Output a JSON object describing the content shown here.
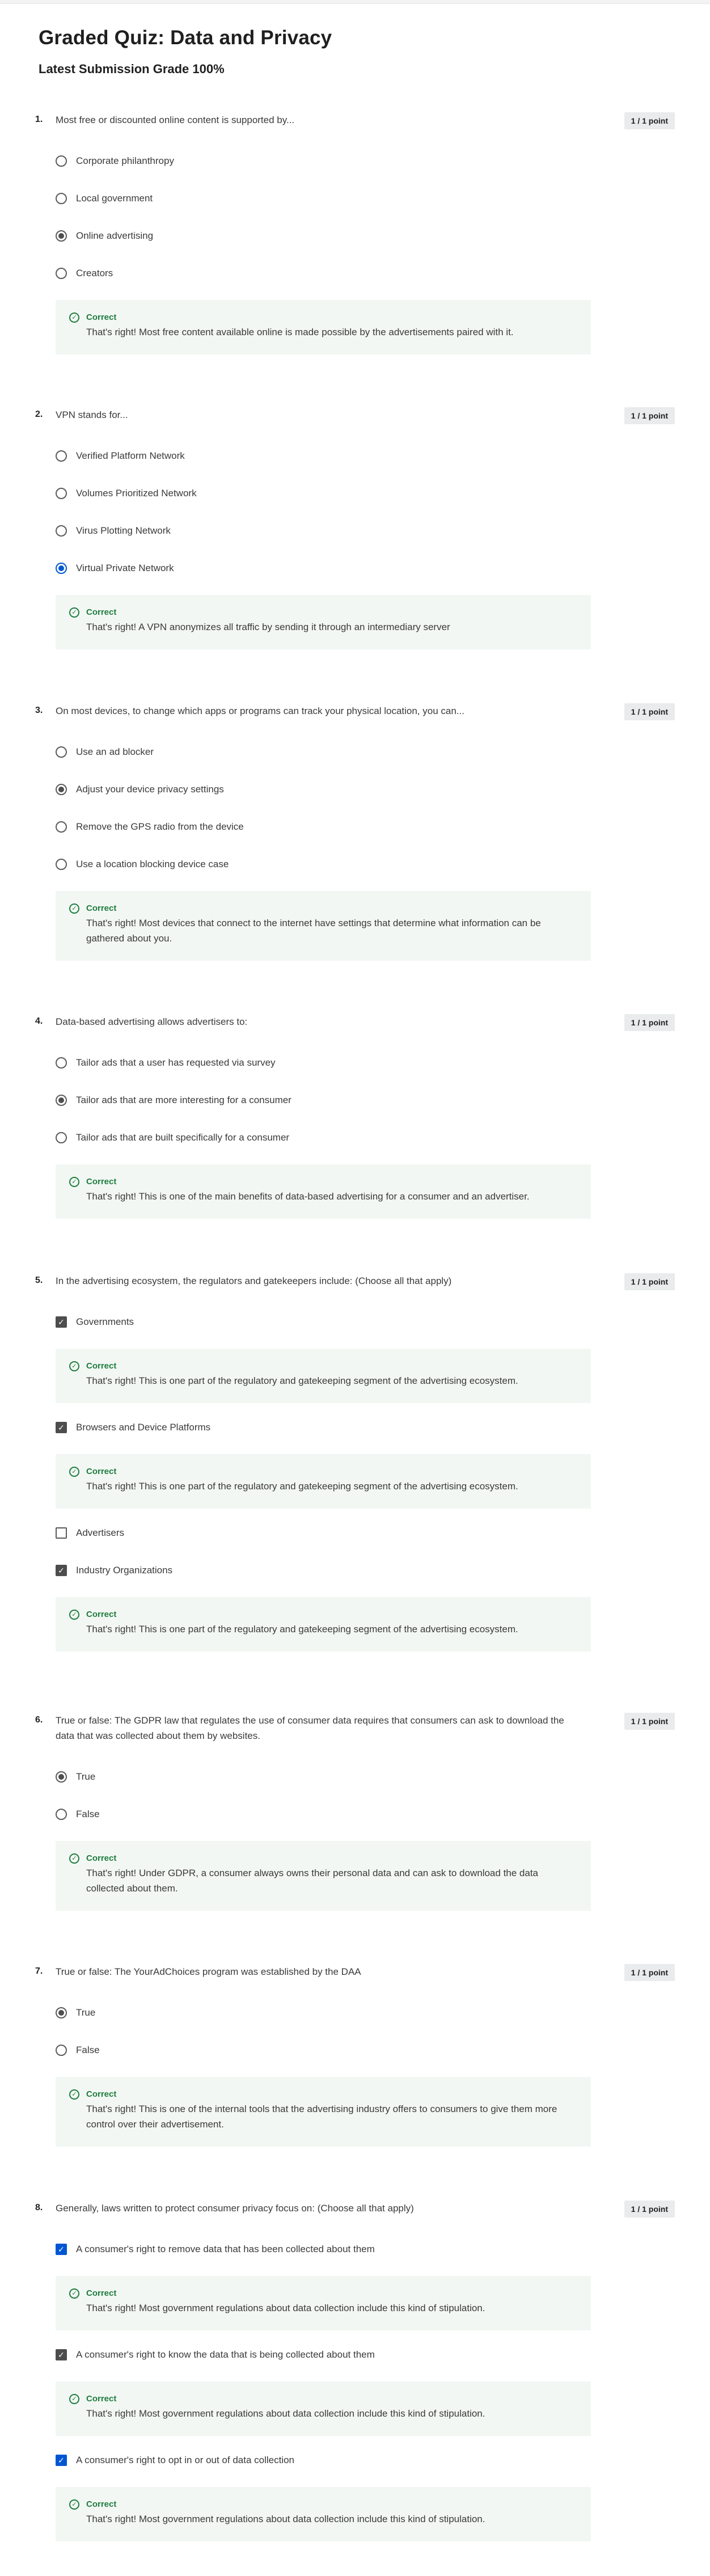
{
  "page": {
    "title": "Graded Quiz: Data and Privacy",
    "grade": "Latest Submission Grade 100%"
  },
  "questions": [
    {
      "number": "1.",
      "prompt": "Most free or discounted online content is supported by...",
      "points": "1 / 1 point",
      "options": [
        "Corporate philanthropy",
        "Local government",
        "Online advertising",
        "Creators"
      ],
      "selected": 2,
      "feedback": {
        "title": "Correct",
        "text": "That's right! Most free content available online is made possible by the advertisements paired with it."
      }
    },
    {
      "number": "2.",
      "prompt": "VPN stands for...",
      "points": "1 / 1 point",
      "options": [
        "Verified Platform Network",
        "Volumes Prioritized Network",
        "Virus Plotting Network",
        "Virtual Private Network"
      ],
      "selected": 3,
      "feedback": {
        "title": "Correct",
        "text": "That's right! A VPN anonymizes all traffic by sending it through an intermediary server"
      }
    },
    {
      "number": "3.",
      "prompt": "On most devices, to change which apps or programs can track your physical location, you can...",
      "points": "1 / 1 point",
      "options": [
        "Use an ad blocker",
        "Adjust your device privacy settings",
        "Remove the GPS radio from the device",
        "Use a location blocking device case"
      ],
      "selected": 1,
      "feedback": {
        "title": "Correct",
        "text": "That's right! Most devices that connect to the internet have settings that determine what information can be gathered about you."
      }
    },
    {
      "number": "4.",
      "prompt": "Data-based advertising allows advertisers to:",
      "points": "1 / 1 point",
      "options": [
        "Tailor ads that a user has requested via survey",
        "Tailor ads that are more interesting for a consumer",
        "Tailor ads that are built specifically for a consumer"
      ],
      "selected": 1,
      "feedback": {
        "title": "Correct",
        "text": "That's right! This is one of the main benefits of data-based advertising for a consumer and an advertiser."
      }
    },
    {
      "number": "5.",
      "prompt": "In the advertising ecosystem, the regulators and gatekeepers include: (Choose all that apply)",
      "points": "1 / 1 point",
      "items": [
        {
          "label": "Governments",
          "checked": true,
          "feedback": {
            "title": "Correct",
            "text": "That's right! This is one part of the regulatory and gatekeeping segment of the advertising ecosystem."
          }
        },
        {
          "label": "Browsers and Device Platforms",
          "checked": true,
          "feedback": {
            "title": "Correct",
            "text": "That's right! This is one part of the regulatory and gatekeeping segment of the advertising ecosystem."
          }
        },
        {
          "label": "Advertisers",
          "checked": false
        },
        {
          "label": "Industry Organizations",
          "checked": true,
          "feedback": {
            "title": "Correct",
            "text": "That's right! This is one part of the regulatory and gatekeeping segment of the advertising ecosystem."
          }
        }
      ]
    },
    {
      "number": "6.",
      "prompt": "True or false: The GDPR law that regulates the use of consumer data requires that consumers can ask to download the data that was collected about them by websites.",
      "points": "1 / 1 point",
      "options": [
        "True",
        "False"
      ],
      "selected": 0,
      "feedback": {
        "title": "Correct",
        "text": "That's right! Under GDPR, a consumer always owns their personal data and can ask to download the data collected about them."
      }
    },
    {
      "number": "7.",
      "prompt": "True or false: The YourAdChoices program was established by the DAA",
      "points": "1 / 1 point",
      "options": [
        "True",
        "False"
      ],
      "selected": 0,
      "feedback": {
        "title": "Correct",
        "text": "That's right! This is one of the internal tools that the advertising industry offers to consumers to give them more control over their advertisement."
      }
    },
    {
      "number": "8.",
      "prompt": "Generally, laws written to protect consumer privacy focus on: (Choose all that apply)",
      "points": "1 / 1 point",
      "items": [
        {
          "label": "A consumer's right to remove data that has been collected about them",
          "checked": true,
          "feedback": {
            "title": "Correct",
            "text": "That's right! Most government regulations about data collection include this kind of stipulation."
          }
        },
        {
          "label": "A consumer's right to know the data that is being collected about them",
          "checked": true,
          "feedback": {
            "title": "Correct",
            "text": "That's right! Most government regulations about data collection include this kind of stipulation."
          }
        },
        {
          "label": "A consumer's right to opt in or out of data collection",
          "checked": true,
          "feedback": {
            "title": "Correct",
            "text": "That's right! Most government regulations about data collection include this kind of stipulation."
          }
        }
      ]
    }
  ]
}
